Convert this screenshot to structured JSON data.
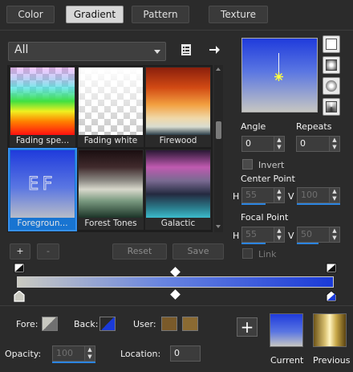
{
  "tabs": [
    "Color",
    "Gradient",
    "Pattern",
    "Texture"
  ],
  "active_tab": "Gradient",
  "category": {
    "value": "All"
  },
  "presets": [
    {
      "label": "Fading spe..."
    },
    {
      "label": "Fading white"
    },
    {
      "label": "Firewood"
    },
    {
      "label": "Foregroun...",
      "selected": true,
      "overlay": "EF"
    },
    {
      "label": "Forest Tones"
    },
    {
      "label": "Galactic"
    }
  ],
  "buttons": {
    "add": "+",
    "remove": "-",
    "reset": "Reset",
    "save": "Save"
  },
  "fields": {
    "angle_label": "Angle",
    "angle_value": "0",
    "repeats_label": "Repeats",
    "repeats_value": "0",
    "invert_label": "Invert",
    "center_label": "Center Point",
    "center_h_label": "H",
    "center_h_value": "55",
    "center_v_label": "V",
    "center_v_value": "100",
    "focal_label": "Focal Point",
    "focal_h_label": "H",
    "focal_h_value": "55",
    "focal_v_label": "V",
    "focal_v_value": "50",
    "link_label": "Link"
  },
  "bottom": {
    "fore_label": "Fore:",
    "back_label": "Back:",
    "user_label": "User:",
    "opacity_label": "Opacity:",
    "opacity_value": "100",
    "location_label": "Location:",
    "location_value": "0",
    "current_label": "Current",
    "previous_label": "Previous"
  },
  "colors": {
    "accent": "#1874d1",
    "gradient_start": "#cbcbc2",
    "gradient_end": "#1a3ad8",
    "user_swatch_1": "#7a5a2a",
    "user_swatch_2": "#8a6a32"
  }
}
